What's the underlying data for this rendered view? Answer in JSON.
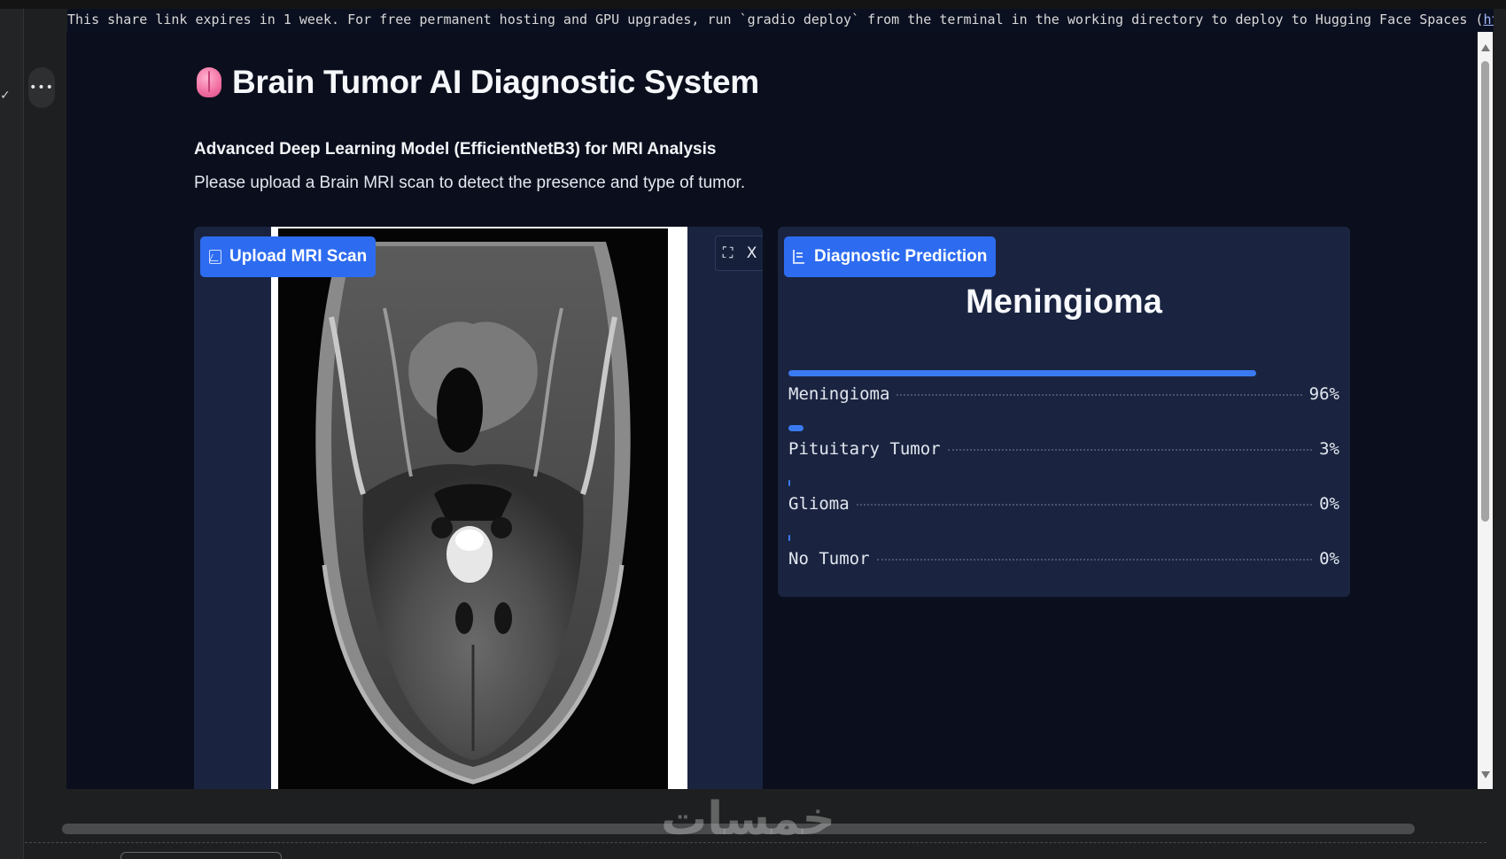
{
  "browser": {
    "share_notice": "This share link expires in 1 week. For free permanent hosting and GPU upgrades, run `gradio deploy` from the terminal in the working directory to deploy to Hugging Face Spaces (",
    "share_link": "https://huggingfac",
    "more_icon": "more-dots-icon",
    "check_icon": "check-icon"
  },
  "app": {
    "title": "Brain Tumor AI Diagnostic System",
    "subtitle": "Advanced Deep Learning Model (EfficientNetB3) for MRI Analysis",
    "description": "Please upload a Brain MRI scan to detect the presence and type of tumor.",
    "title_icon": "brain-icon",
    "accent_color": "#2d6cf0",
    "background_color": "#0b0f1d",
    "panel_color": "#1a2440"
  },
  "upload_panel": {
    "label": "Upload MRI Scan",
    "label_icon": "image-icon",
    "toolbar": {
      "fullscreen_icon": "fullscreen-icon",
      "close_icon": "close-icon",
      "fullscreen_symbol": "⛶",
      "close_symbol": "X"
    }
  },
  "prediction_panel": {
    "label": "Diagnostic Prediction",
    "label_icon": "bar-chart-icon",
    "predicted_class": "Meningioma",
    "confidences": [
      {
        "label": "Meningioma",
        "value": 0.96,
        "display": "96%"
      },
      {
        "label": "Pituitary Tumor",
        "value": 0.03,
        "display": "3%"
      },
      {
        "label": "Glioma",
        "value": 0.0,
        "display": "0%"
      },
      {
        "label": "No Tumor",
        "value": 0.0,
        "display": "0%"
      }
    ]
  },
  "watermark": {
    "text": "خمسات"
  }
}
